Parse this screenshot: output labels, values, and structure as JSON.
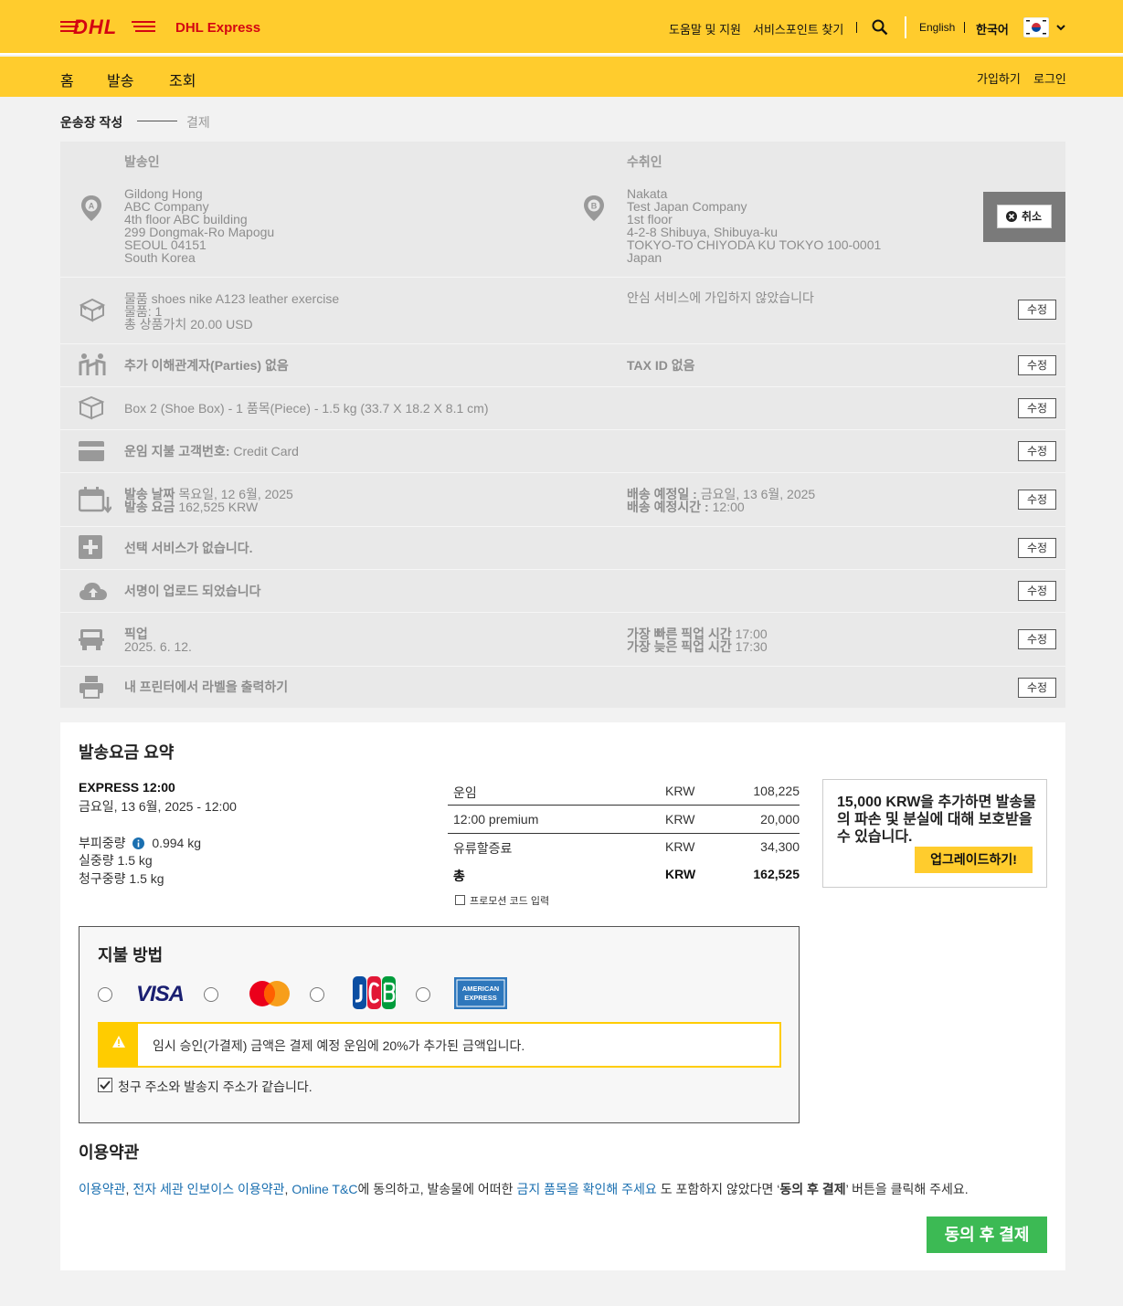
{
  "header": {
    "brand_text": "DHL Express",
    "help": "도움말 및 지원",
    "service_points": "서비스포인트 찾기",
    "lang_en": "English",
    "lang_ko": "한국어"
  },
  "nav": {
    "home": "홈",
    "ship": "발송",
    "track": "조회",
    "signup": "가입하기",
    "login": "로그인"
  },
  "breadcrumb": {
    "step1": "운송장 작성",
    "step2": "결제"
  },
  "sender": {
    "heading": "발송인",
    "lines": [
      "Gildong Hong",
      "ABC Company",
      "4th floor ABC building",
      "299 Dongmak-Ro Mapogu",
      "SEOUL 04151",
      "South Korea"
    ]
  },
  "receiver": {
    "heading": "수취인",
    "lines": [
      "Nakata",
      "Test Japan Company",
      "1st floor",
      "4-2-8 Shibuya, Shibuya-ku",
      "TOKYO-TO CHIYODA KU TOKYO 100-0001",
      "Japan"
    ]
  },
  "cancel_label": "취소",
  "edit_label": "수정",
  "items": {
    "label1": "물품",
    "value1": "shoes nike A123 leather exercise",
    "label2": "물품:",
    "value2": "1",
    "label3": "총 상품가치",
    "value3": "20.00 USD",
    "insurance": "안심 서비스에 가입하지 않았습니다"
  },
  "parties": {
    "text": "추가 이해관계자(Parties) 없음",
    "tax": "TAX ID 없음"
  },
  "package": {
    "text": "Box 2 (Shoe Box) - 1 품목(Piece) - 1.5 kg (33.7 X 18.2 X 8.1 cm)"
  },
  "billing": {
    "label": "운임 지불 고객번호:",
    "value": "Credit Card"
  },
  "dates": {
    "ship_label": "발송 날짜",
    "ship_value": "목요일, 12 6월, 2025",
    "fee_label": "발송 요금",
    "fee_value": "162,525 KRW",
    "delivery_label": "배송 예정일 :",
    "delivery_value": "금요일, 13 6월, 2025",
    "time_label": "배송 예정시간 :",
    "time_value": "12:00"
  },
  "optional": {
    "text": "선택 서비스가 없습니다."
  },
  "signature": {
    "text": "서명이 업로드 되었습니다"
  },
  "pickup": {
    "label": "픽업",
    "date": "2025. 6. 12.",
    "earliest_label": "가장 빠른 픽업 시간",
    "earliest": "17:00",
    "latest_label": "가장 늦은 픽업 시간",
    "latest": "17:30"
  },
  "print": {
    "text": "내 프린터에서 라벨을 출력하기"
  },
  "summary": {
    "title": "발송요금 요약",
    "product": "EXPRESS 12:00",
    "product_date": "금요일, 13 6월, 2025 - 12:00",
    "vol_label": "부피중량",
    "vol": "0.994 kg",
    "actual_label": "실중량",
    "actual": "1.5 kg",
    "charge_label": "청구중량",
    "charge": "1.5 kg",
    "rows": [
      {
        "name": "운임",
        "cur": "KRW",
        "amt": "108,225"
      },
      {
        "name": "12:00 premium",
        "cur": "KRW",
        "amt": "20,000"
      },
      {
        "name": "유류할증료",
        "cur": "KRW",
        "amt": "34,300"
      }
    ],
    "total": {
      "name": "총",
      "cur": "KRW",
      "amt": "162,525"
    },
    "promo": "프로모션 코드 입력",
    "upgrade_text": "15,000 KRW을 추가하면 발송물의 파손 및 분실에 대해 보호받을 수 있습니다.",
    "upgrade_btn": "업그레이드하기!"
  },
  "payment": {
    "title": "지불 방법",
    "visa": "VISA",
    "warning": "임시 승인(가결제) 금액은 결제 예정 운임에 20%가 추가된 금액입니다.",
    "same_address": "청구 주소와 발송지 주소가 같습니다."
  },
  "terms": {
    "title": "이용약관",
    "link1": "이용약관",
    "sep1": ", ",
    "link2": "전자 세관 인보이스 이용약관",
    "sep2": ", ",
    "link3": "Online T&C",
    "mid": "에 동의하고, 발송물에 어떠한 ",
    "link4": "금지 품목을 확인해 주세요",
    "tail1": " 도 포함하지 않았다면 ‘",
    "bold": "동의 후 결제",
    "tail2": "’ 버튼을 클릭해 주세요.",
    "agree_btn": "동의 후 결제"
  },
  "colors": {
    "yellow": "#ffcc2d",
    "red": "#d40511",
    "green": "#3cba54"
  }
}
